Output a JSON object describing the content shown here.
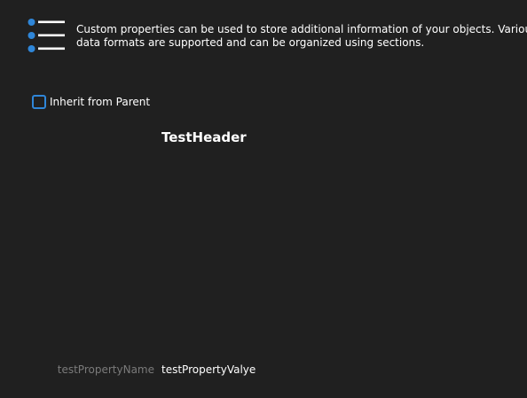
{
  "header": {
    "icon": "list-bullets-icon",
    "description": "Custom properties can be used to store additional information of your objects. Various data formats are supported and can be organized using sections."
  },
  "inherit": {
    "label": "Inherit from Parent",
    "checked": false
  },
  "section": {
    "title": "TestHeader"
  },
  "properties": [
    {
      "name": "testPropertyName",
      "value": "testPropertyValye"
    }
  ],
  "colors": {
    "background": "#202020",
    "accent": "#2f86d8",
    "muted_text": "#7a7a7a",
    "text": "#ffffff"
  }
}
